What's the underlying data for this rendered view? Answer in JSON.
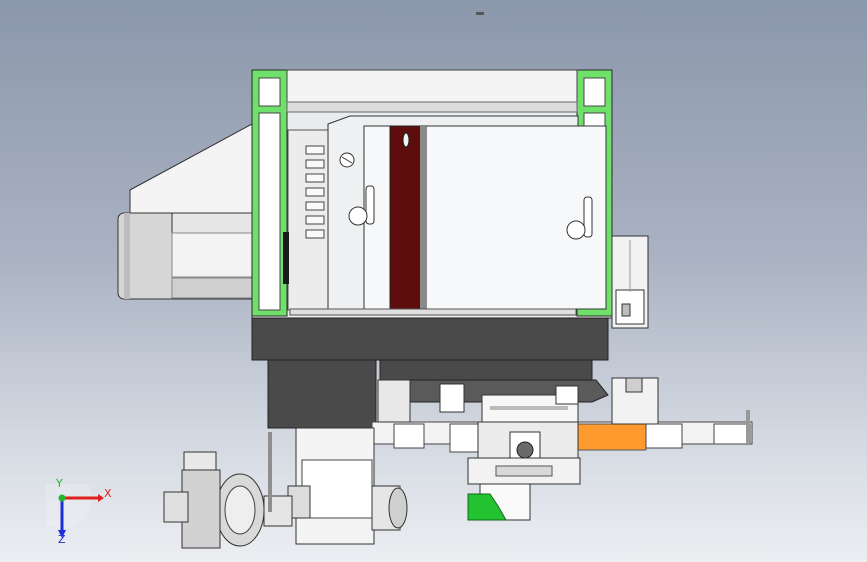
{
  "viewport": {
    "background_top": "#8b97ab",
    "background_bottom": "#eceef2"
  },
  "triad": {
    "x_label": "X",
    "y_label": "Y",
    "z_label": "Z",
    "x_color": "#e0201e",
    "y_color": "#23b82e",
    "z_color": "#1f2fd6"
  },
  "model": {
    "frame_color": "#6fe06a",
    "door_accent_color": "#5e0d0d",
    "base_color": "#4a4a4a",
    "feeder_color": "#ff9a2e",
    "bracket_color": "#22c230"
  }
}
